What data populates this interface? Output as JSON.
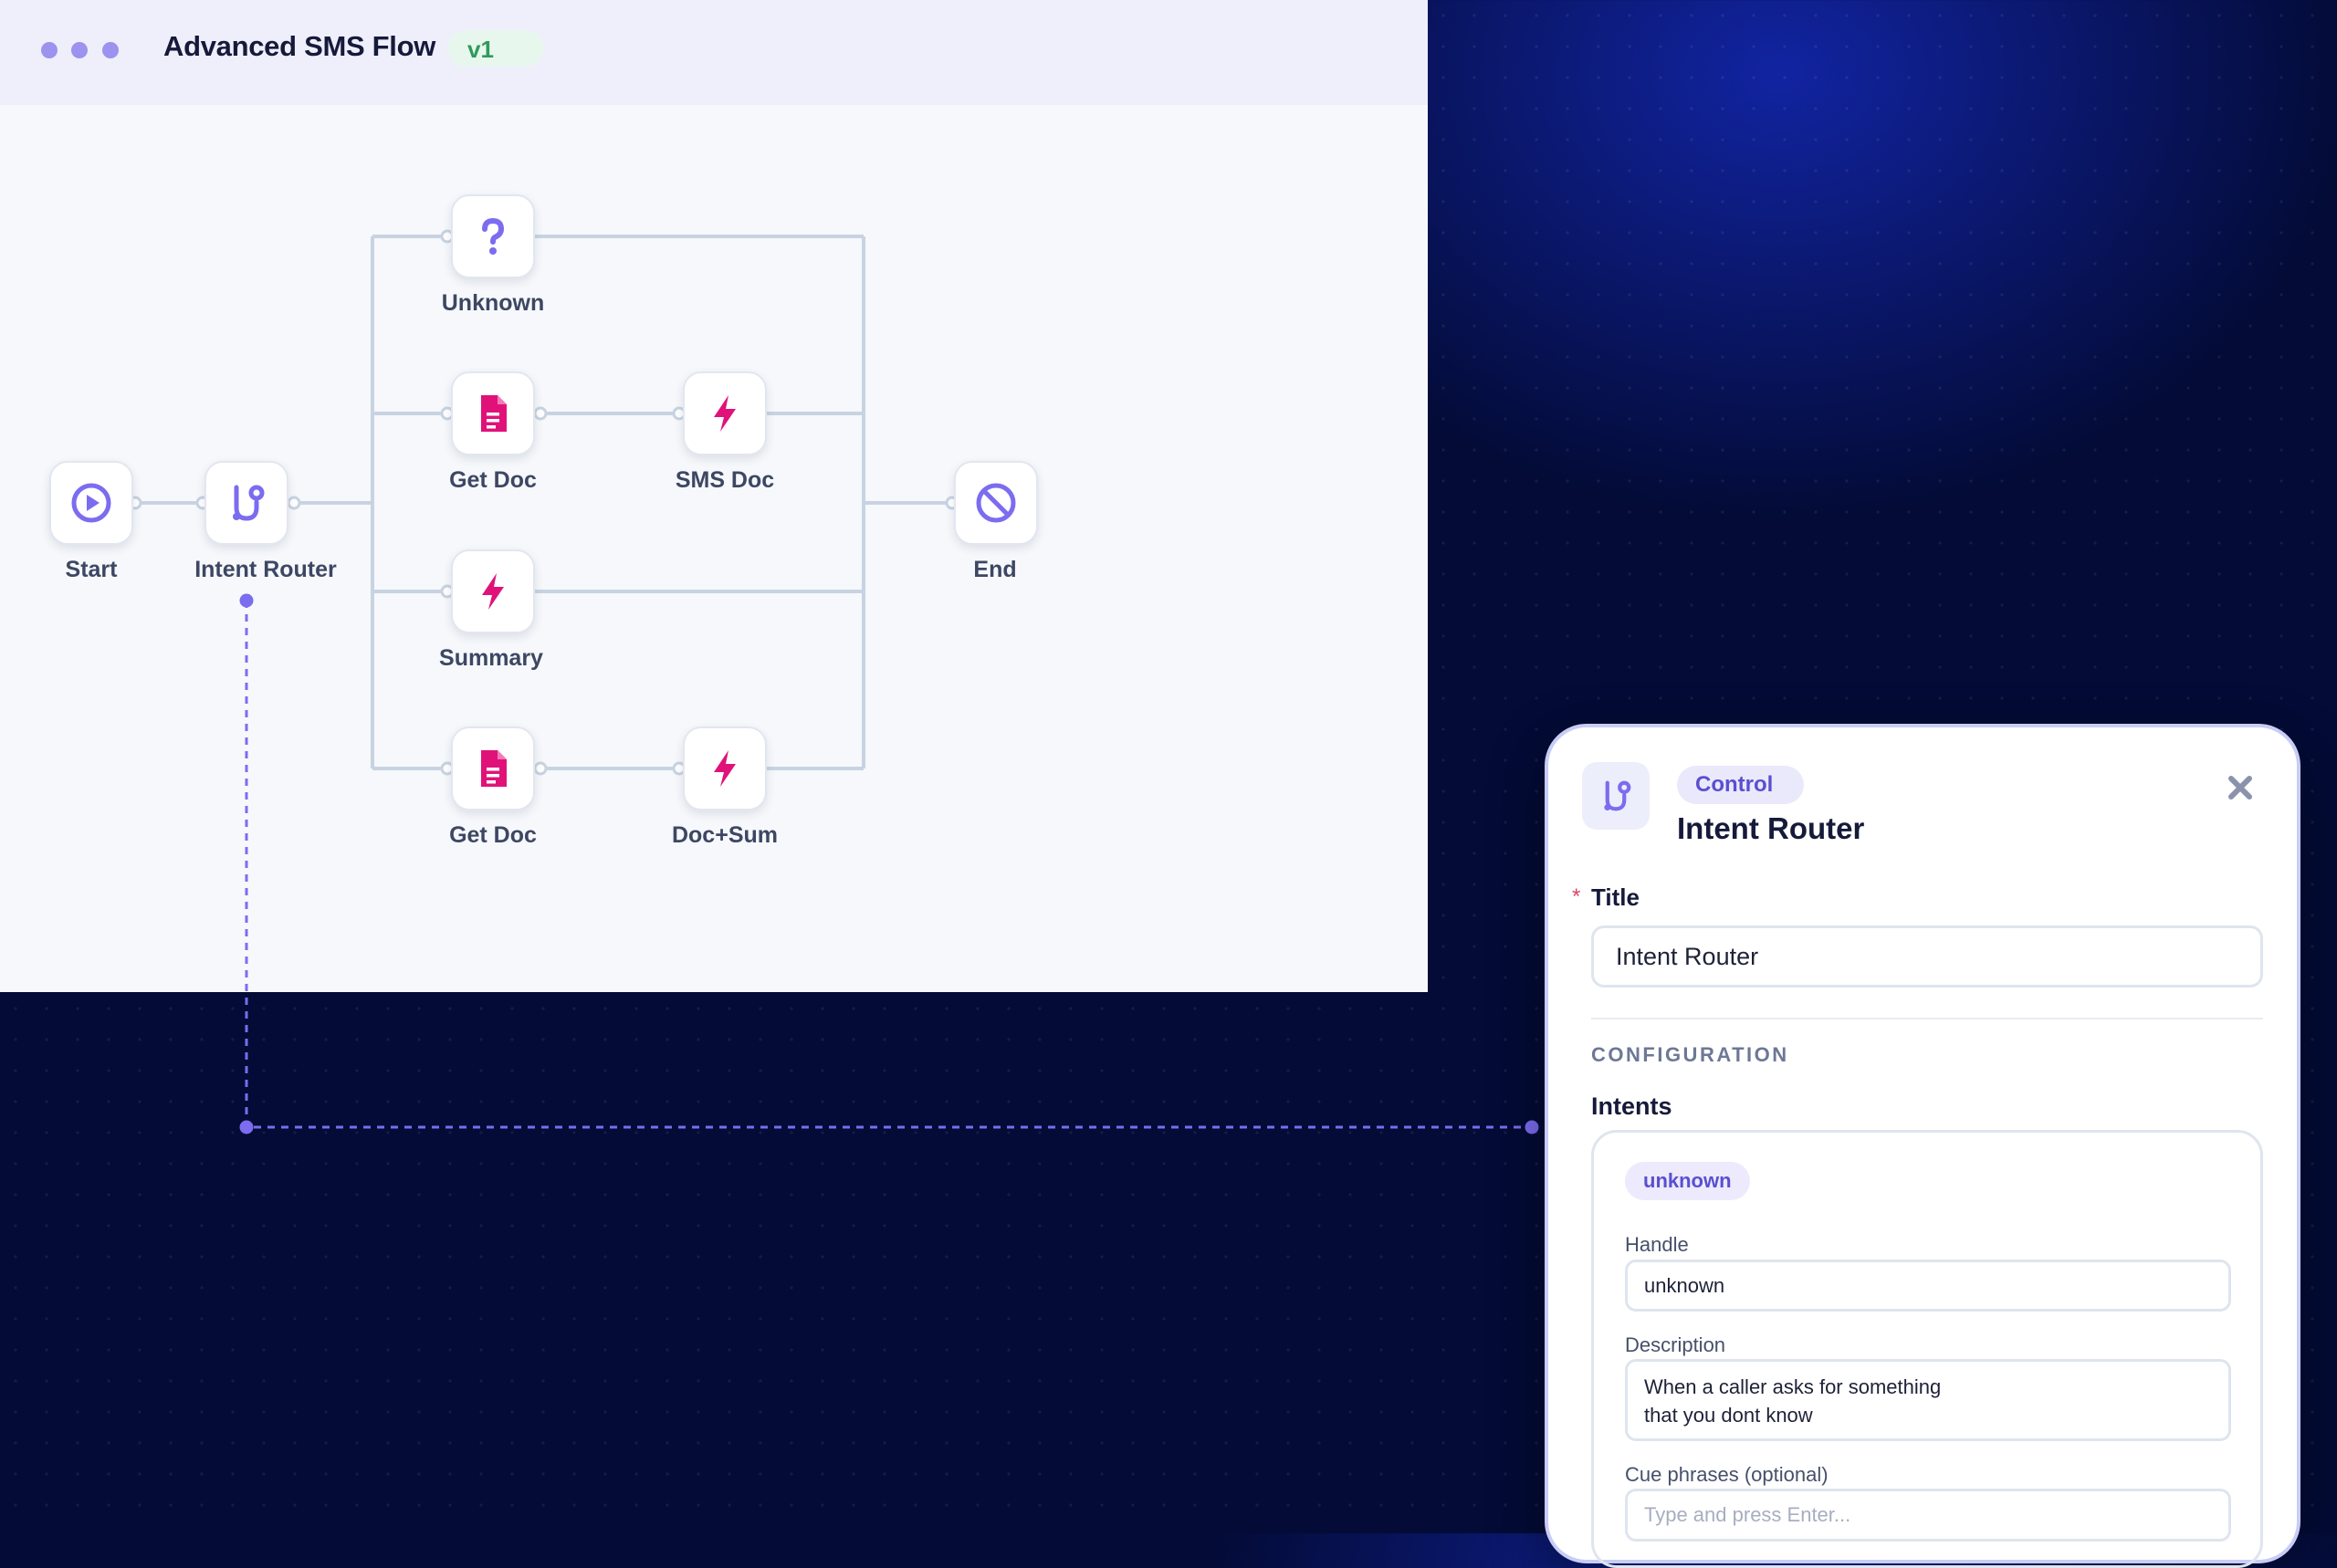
{
  "window": {
    "title": "Advanced SMS Flow",
    "version": "v1"
  },
  "flow": {
    "nodes": [
      {
        "id": "start",
        "label": "Start",
        "icon": "play-circle-icon",
        "color": "#7b6cf0"
      },
      {
        "id": "intent-router",
        "label": "Intent Router",
        "icon": "branch-icon",
        "color": "#7b6cf0"
      },
      {
        "id": "unknown",
        "label": "Unknown",
        "icon": "question-icon",
        "color": "#7b6cf0"
      },
      {
        "id": "get-doc-1",
        "label": "Get Doc",
        "icon": "document-icon",
        "color": "#e0127a"
      },
      {
        "id": "sms-doc",
        "label": "SMS Doc",
        "icon": "lightning-icon",
        "color": "#e0127a"
      },
      {
        "id": "summary",
        "label": "Summary",
        "icon": "lightning-icon",
        "color": "#e0127a"
      },
      {
        "id": "get-doc-2",
        "label": "Get Doc",
        "icon": "document-icon",
        "color": "#e0127a"
      },
      {
        "id": "doc-sum",
        "label": "Doc+Sum",
        "icon": "lightning-icon",
        "color": "#e0127a"
      },
      {
        "id": "end",
        "label": "End",
        "icon": "block-icon",
        "color": "#7b6cf0"
      }
    ]
  },
  "panel": {
    "category": "Control",
    "title": "Intent Router",
    "title_field": {
      "label": "Title",
      "value": "Intent Router"
    },
    "section_heading": "CONFIGURATION",
    "intents_label": "Intents",
    "intent": {
      "badge": "unknown",
      "handle_label": "Handle",
      "handle_value": "unknown",
      "description_label": "Description",
      "description_value": "When a caller asks for something\nthat you dont know",
      "cue_label": "Cue phrases (optional)",
      "cue_placeholder": "Type and press Enter..."
    }
  },
  "colors": {
    "accent": "#7b6cf0",
    "action": "#e0127a",
    "edge": "#c8d3e2",
    "connector": "#7b6cf0",
    "background": "#030b36"
  }
}
